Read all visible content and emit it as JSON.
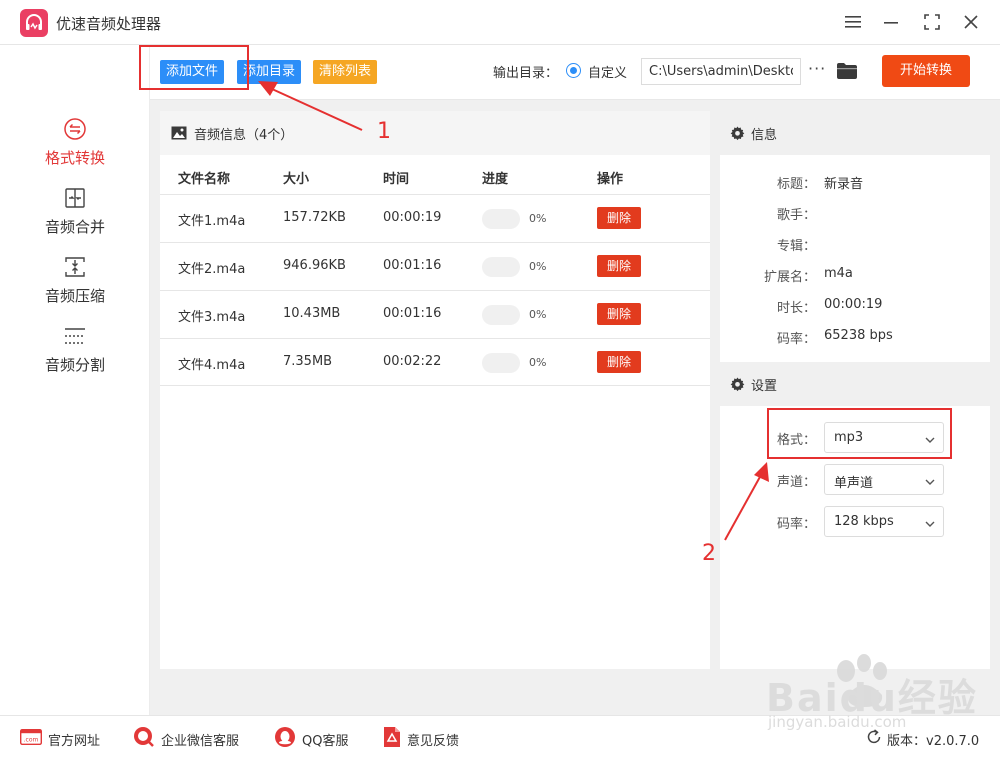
{
  "app": {
    "title": "优速音频处理器"
  },
  "toolbar": {
    "add_file": "添加文件",
    "add_dir": "添加目录",
    "clear_list": "清除列表",
    "output_label": "输出目录：",
    "custom_label": "自定义",
    "output_path": "C:\\Users\\admin\\Desktop",
    "more": "···",
    "start": "开始转换"
  },
  "sidebar": {
    "items": [
      {
        "label": "格式转换",
        "active": true
      },
      {
        "label": "音频合并"
      },
      {
        "label": "音频压缩"
      },
      {
        "label": "音频分割"
      }
    ]
  },
  "list": {
    "header": "音频信息（4个）",
    "columns": [
      "文件名称",
      "大小",
      "时间",
      "进度",
      "操作"
    ],
    "rows": [
      {
        "name": "文件1.m4a",
        "size": "157.72KB",
        "time": "00:00:19",
        "progress": "0%",
        "progress_value": 0,
        "action": "删除"
      },
      {
        "name": "文件2.m4a",
        "size": "946.96KB",
        "time": "00:01:16",
        "progress": "0%",
        "progress_value": 0,
        "action": "删除"
      },
      {
        "name": "文件3.m4a",
        "size": "10.43MB",
        "time": "00:01:16",
        "progress": "0%",
        "progress_value": 0,
        "action": "删除"
      },
      {
        "name": "文件4.m4a",
        "size": "7.35MB",
        "time": "00:02:22",
        "progress": "0%",
        "progress_value": 0,
        "action": "删除"
      }
    ]
  },
  "info": {
    "header": "信息",
    "fields": [
      {
        "label": "标题：",
        "value": "新录音"
      },
      {
        "label": "歌手：",
        "value": ""
      },
      {
        "label": "专辑：",
        "value": ""
      },
      {
        "label": "扩展名：",
        "value": "m4a"
      },
      {
        "label": "时长：",
        "value": "00:00:19"
      },
      {
        "label": "码率：",
        "value": "65238 bps"
      }
    ]
  },
  "settings": {
    "header": "设置",
    "format_label": "格式：",
    "format_value": "mp3",
    "channel_label": "声道：",
    "channel_value": "单声道",
    "bitrate_label": "码率：",
    "bitrate_value": "128 kbps"
  },
  "bottom": {
    "website": "官方网址",
    "wechat": "企业微信客服",
    "qq": "QQ客服",
    "feedback": "意见反馈",
    "version": "版本：v2.0.7.0"
  },
  "annotations": {
    "n1": "1",
    "n2": "2"
  },
  "watermark": {
    "brand": "Baidu经验",
    "url": "jingyan.baidu.com"
  },
  "colors": {
    "accent_blue": "#2c8ef8",
    "accent_orange": "#f5a623",
    "start_red": "#f04a14",
    "delete_red": "#e23b1e",
    "active_red": "#e23838",
    "annotation_red": "#e53030"
  }
}
